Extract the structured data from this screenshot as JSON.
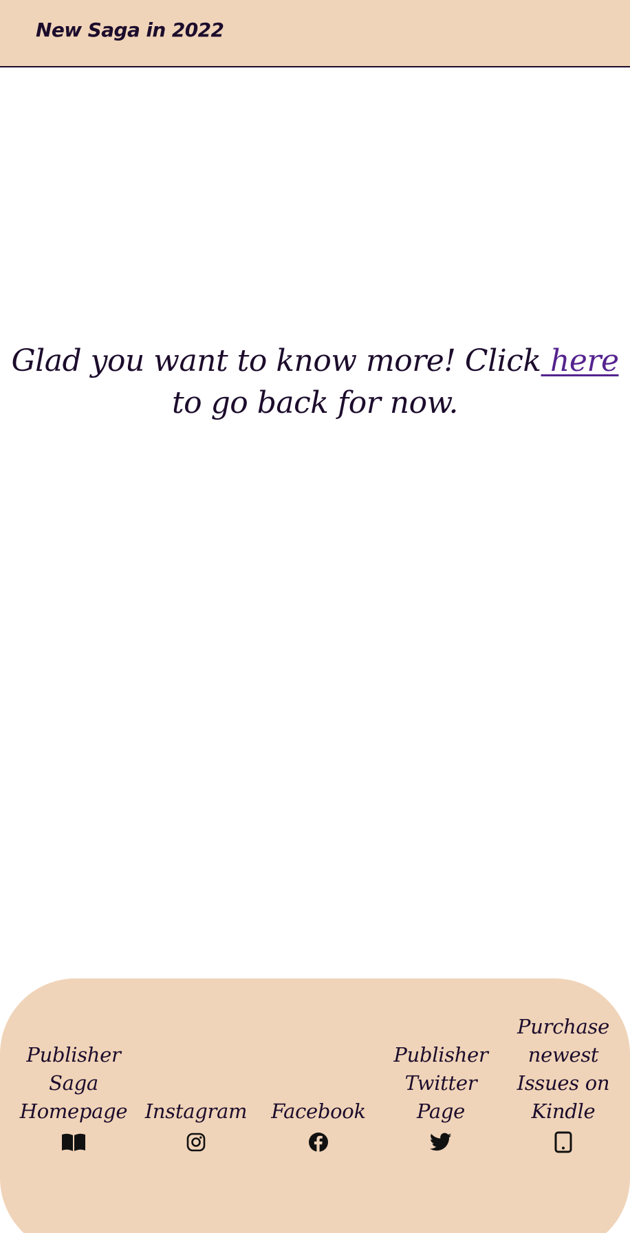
{
  "header": {
    "brand": "New Saga in 2022"
  },
  "main": {
    "message_before": "Glad you want to know more! Click",
    "link_label": " here ",
    "message_after": "to go back for now."
  },
  "footer": {
    "links": [
      {
        "label": "Publisher Saga Homepage",
        "icon": "book-open-icon"
      },
      {
        "label": "Instagram",
        "icon": "instagram-icon"
      },
      {
        "label": "Facebook",
        "icon": "facebook-icon"
      },
      {
        "label": "Publisher Twitter Page",
        "icon": "twitter-icon"
      },
      {
        "label": "Purchase newest Issues on Kindle",
        "icon": "tablet-icon"
      }
    ]
  },
  "colors": {
    "accent_bg": "#f0d4b9",
    "text": "#1c0c2c",
    "link": "#55238f"
  }
}
